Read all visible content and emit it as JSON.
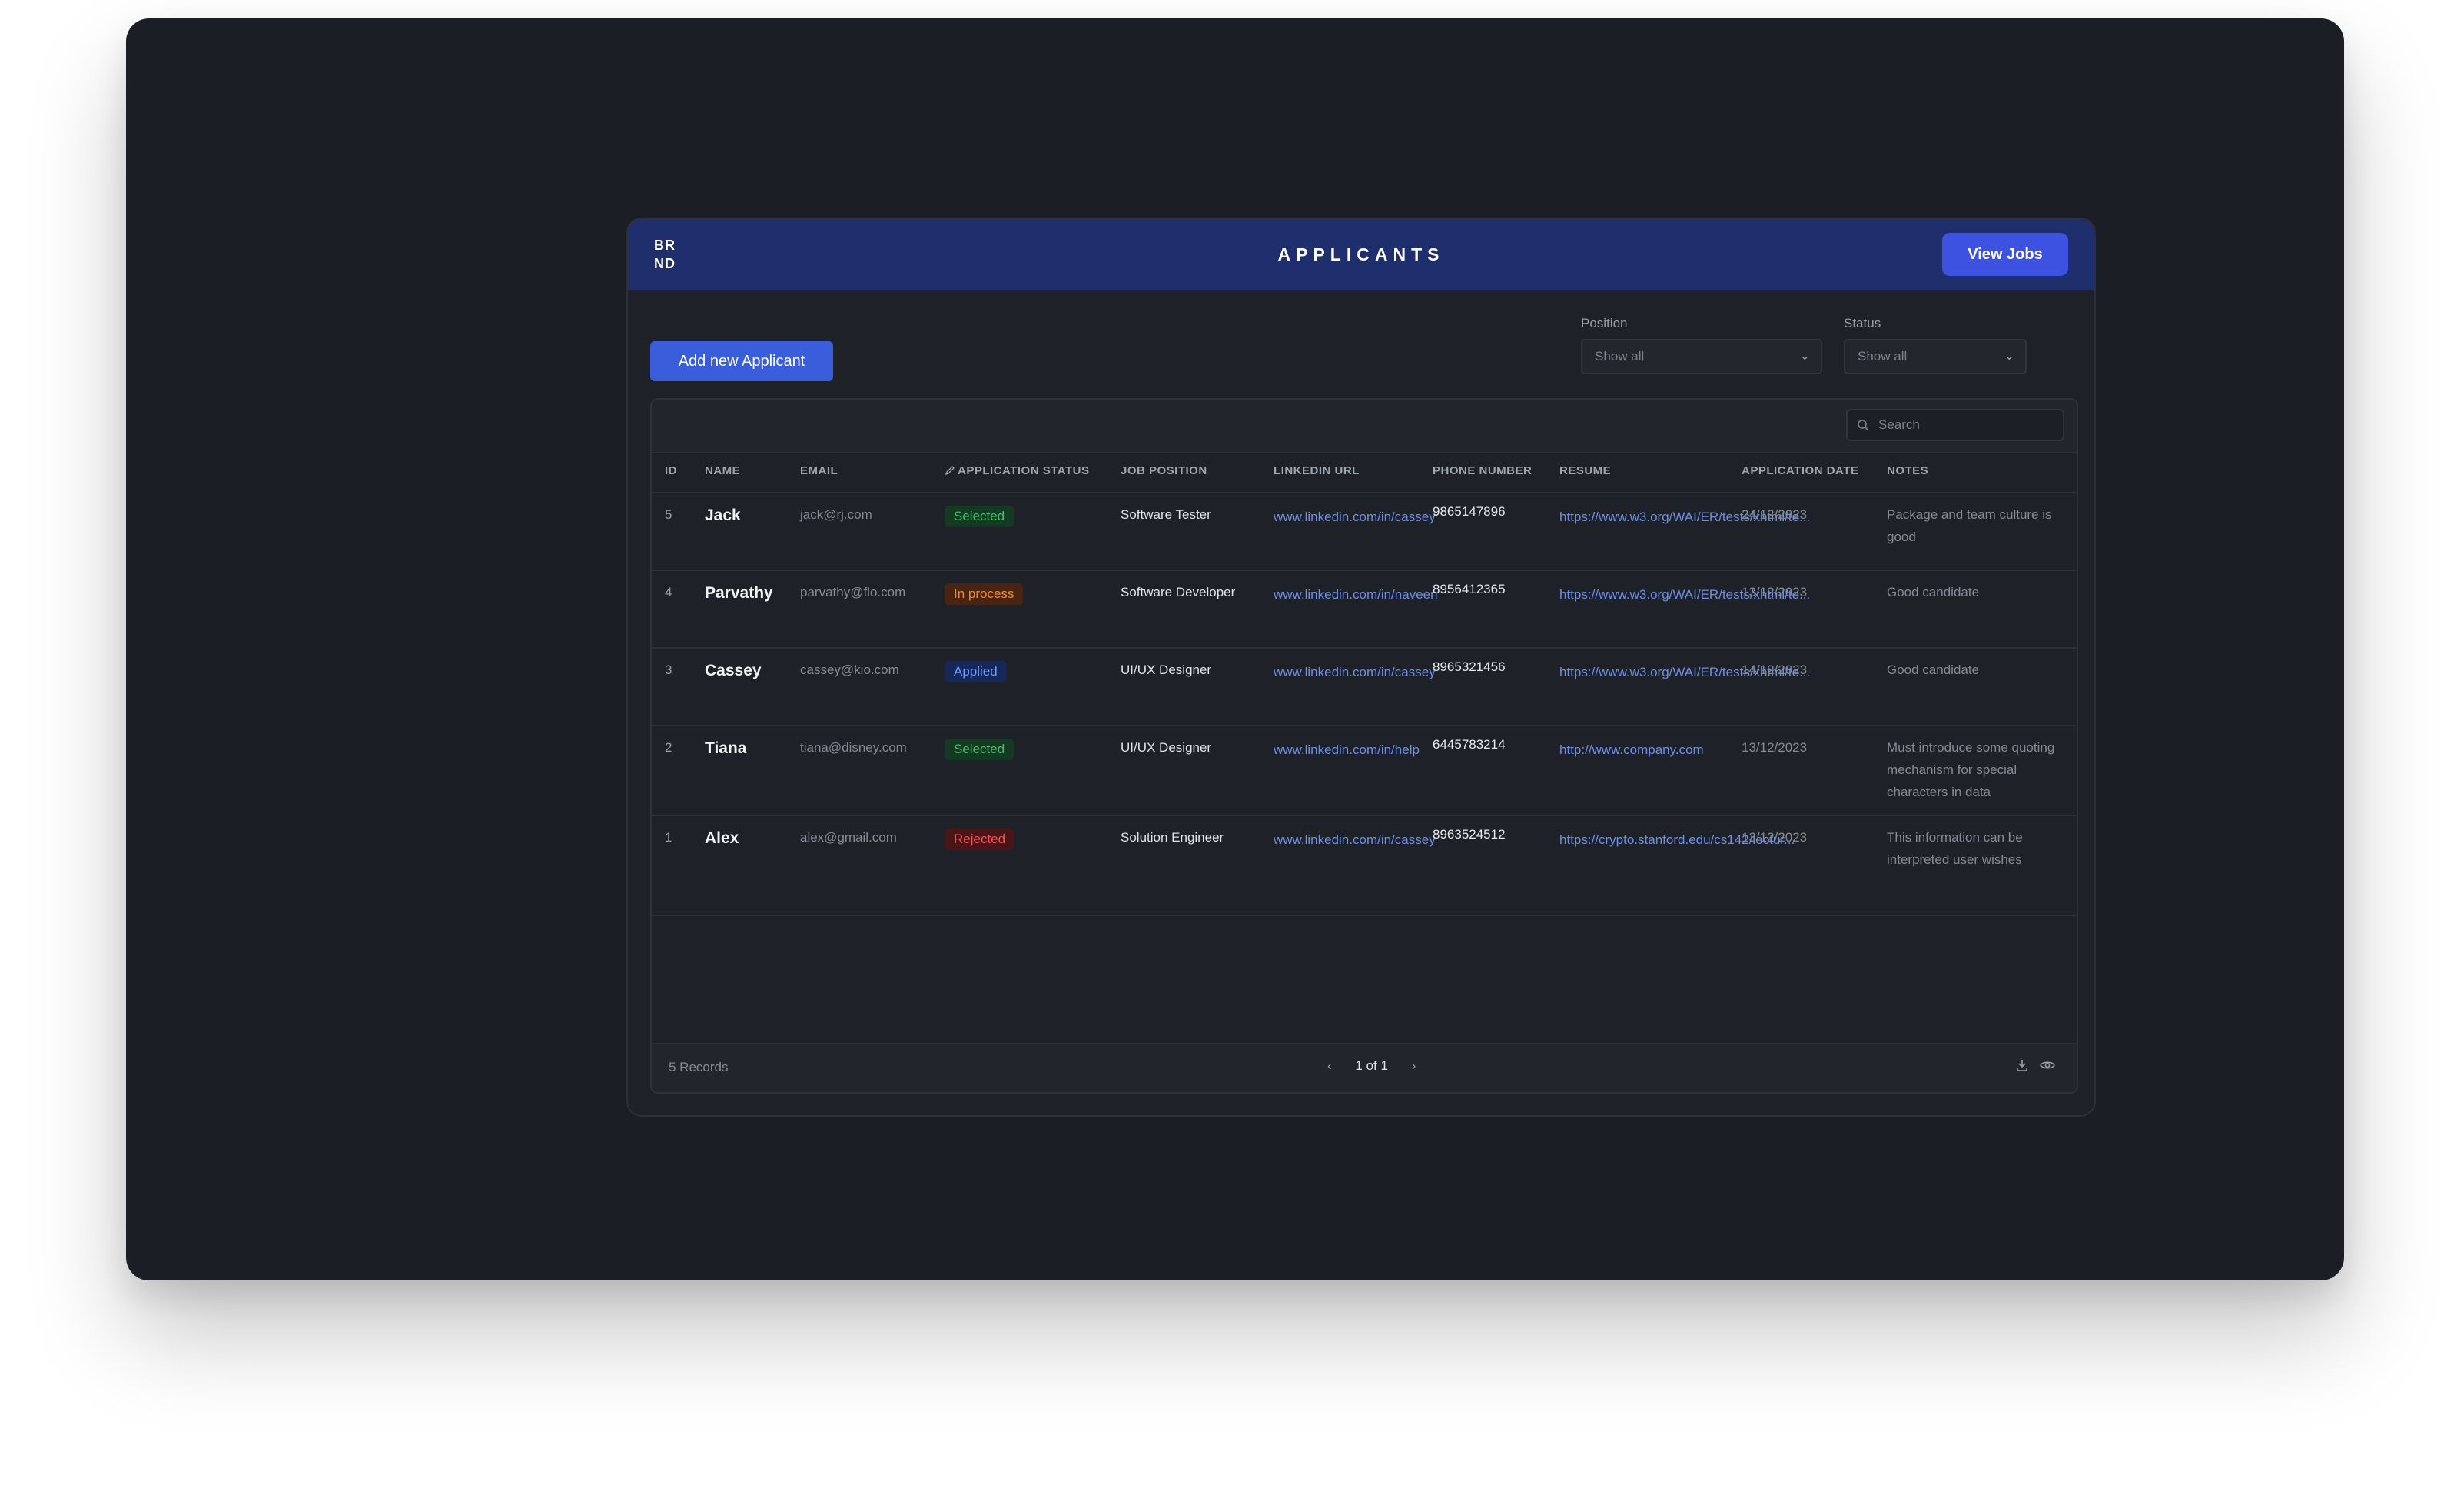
{
  "header": {
    "logo_line1": "BR",
    "logo_line2": "ND",
    "title": "APPLICANTS",
    "view_jobs_label": "View Jobs"
  },
  "toolbar": {
    "add_label": "Add new Applicant"
  },
  "filters": {
    "position": {
      "label": "Position",
      "value": "Show all"
    },
    "status": {
      "label": "Status",
      "value": "Show all"
    }
  },
  "search": {
    "placeholder": "Search"
  },
  "columns": {
    "id": "ID",
    "name": "NAME",
    "email": "EMAIL",
    "status": "APPLICATION STATUS",
    "job": "JOB POSITION",
    "linkedin": "LINKEDIN URL",
    "phone": "PHONE NUMBER",
    "resume": "RESUME",
    "date": "APPLICATION DATE",
    "notes": "NOTES"
  },
  "rows": [
    {
      "id": "5",
      "name": "Jack",
      "email": "jack@rj.com",
      "status": "Selected",
      "job": "Software Tester",
      "linkedin": "www.linkedin.com/in/cassey",
      "phone": "9865147896",
      "resume": "https://www.w3.org/WAI/ER/tests/xhtml/te...",
      "date": "24/12/2023",
      "notes": "Package and team culture is good"
    },
    {
      "id": "4",
      "name": "Parvathy",
      "email": "parvathy@flo.com",
      "status": "In process",
      "job": "Software Developer",
      "linkedin": "www.linkedin.com/in/naveen",
      "phone": "8956412365",
      "resume": "https://www.w3.org/WAI/ER/tests/xhtml/te...",
      "date": "13/12/2023",
      "notes": "Good candidate"
    },
    {
      "id": "3",
      "name": "Cassey",
      "email": "cassey@kio.com",
      "status": "Applied",
      "job": "UI/UX Designer",
      "linkedin": "www.linkedin.com/in/cassey",
      "phone": "8965321456",
      "resume": "https://www.w3.org/WAI/ER/tests/xhtml/te...",
      "date": "14/12/2023",
      "notes": "Good candidate"
    },
    {
      "id": "2",
      "name": "Tiana",
      "email": "tiana@disney.com",
      "status": "Selected",
      "job": "UI/UX Designer",
      "linkedin": "www.linkedin.com/in/help",
      "phone": "6445783214",
      "resume": "http://www.company.com",
      "date": "13/12/2023",
      "notes": "Must introduce some quoting mechanism for special characters in data"
    },
    {
      "id": "1",
      "name": "Alex",
      "email": "alex@gmail.com",
      "status": "Rejected",
      "job": "Solution Engineer",
      "linkedin": "www.linkedin.com/in/cassey",
      "phone": "8963524512",
      "resume": "https://crypto.stanford.edu/cs142/lectur...",
      "date": "13/12/2023",
      "notes": "This information can be interpreted user wishes"
    }
  ],
  "status_colors": {
    "Selected": {
      "fg": "#3ec26a",
      "bg": "#153a22"
    },
    "In process": {
      "fg": "#f08a2c",
      "bg": "#4a2410"
    },
    "Applied": {
      "fg": "#6f9cff",
      "bg": "#16275a"
    },
    "Rejected": {
      "fg": "#f0565a",
      "bg": "#4a1517"
    }
  },
  "footer": {
    "records": "5 Records",
    "page_info": "1 of 1"
  },
  "icons": {
    "search": "search-icon",
    "edit": "pencil-icon",
    "prev": "chevron-left-icon",
    "next": "chevron-right-icon",
    "download": "download-icon",
    "view": "eye-icon",
    "dropdown": "chevron-down-icon"
  }
}
